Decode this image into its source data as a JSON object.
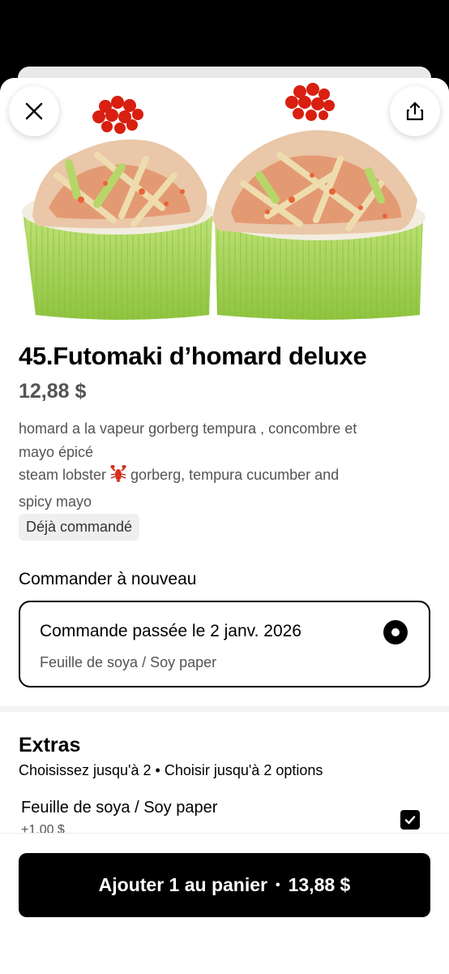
{
  "product": {
    "title": "45.Futomaki d’homard deluxe",
    "price": "12,88 $",
    "description_line1": "homard a la vapeur gorberg tempura , concombre et",
    "description_line2": "mayo épicé",
    "description_line3_before": "steam lobster",
    "description_line3_after": "gorberg, tempura cucumber and",
    "description_line4": "spicy mayo",
    "badge": "Déjà commandé",
    "image_alt": "Futomaki d’homard deluxe"
  },
  "reorder": {
    "heading": "Commander à nouveau",
    "order_title": "Commande passée le 2 janv. 2026",
    "order_items": "Feuille de soya / Soy paper"
  },
  "extras": {
    "title": "Extras",
    "subtitle": "Choisissez jusqu'à 2 • Choisir jusqu'à 2 options",
    "options": [
      {
        "label": "Feuille de soya / Soy paper",
        "price": "+1,00 $",
        "checked": true
      }
    ]
  },
  "footer": {
    "add_label": "Ajouter 1 au panier",
    "separator": "•",
    "total": "13,88 $"
  },
  "icons": {
    "close": "close-icon",
    "share": "share-icon",
    "lobster": "lobster-emoji",
    "checkmark": "checkmark-icon"
  },
  "colors": {
    "primary": "#000000",
    "secondary_text": "#545454",
    "badge_bg": "#efefef",
    "nori_green": "#a6d65a",
    "roe_red": "#d81f10"
  }
}
